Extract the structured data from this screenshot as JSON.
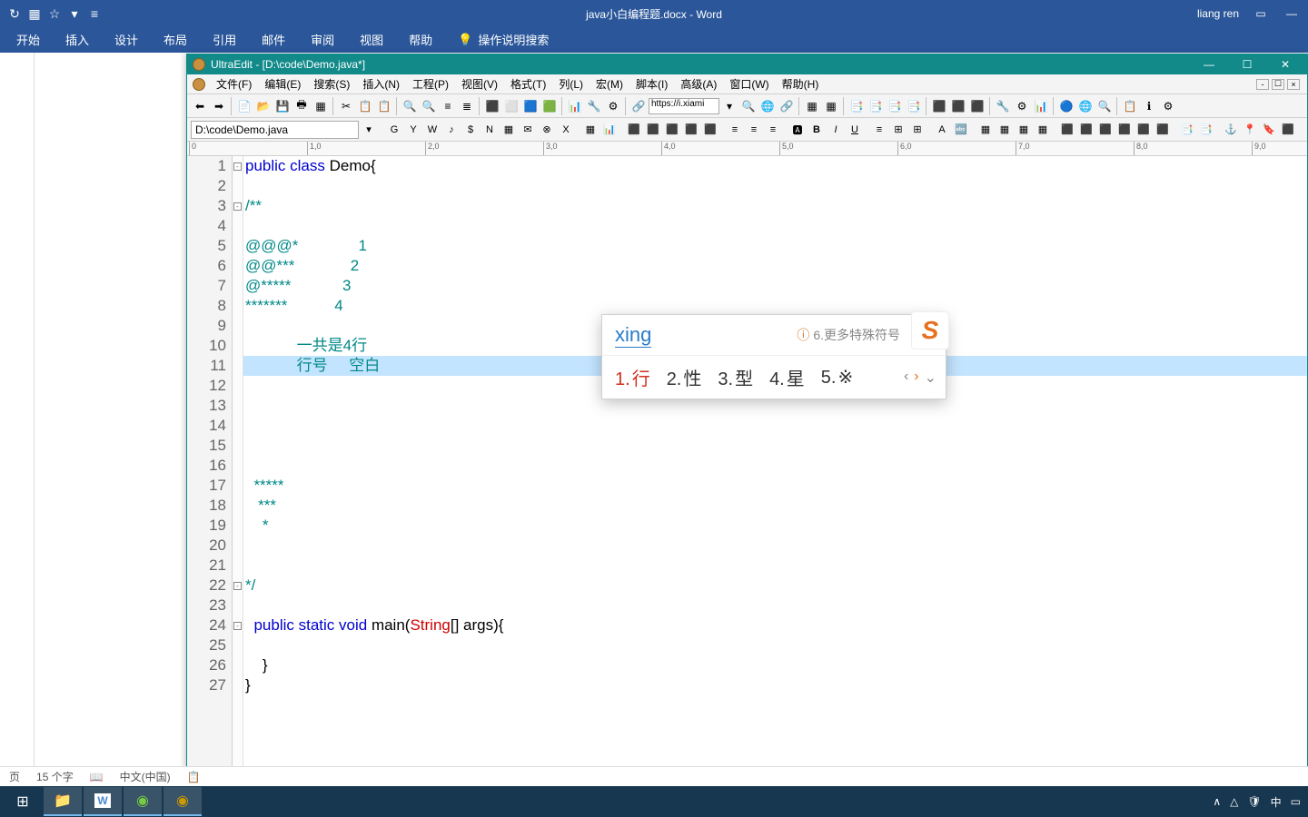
{
  "word": {
    "title": "java小白编程题.docx - Word",
    "user": "liang ren",
    "qat": [
      "↻",
      "▦",
      "☆",
      "▾",
      "≡"
    ],
    "tabs": [
      "开始",
      "插入",
      "设计",
      "布局",
      "引用",
      "邮件",
      "审阅",
      "视图",
      "帮助"
    ],
    "tellme": "操作说明搜索",
    "status": {
      "page": "页",
      "words": "15 个字",
      "lang": "中文(中国)"
    }
  },
  "ue": {
    "title": "UltraEdit - [D:\\code\\Demo.java*]",
    "menus": [
      "文件(F)",
      "编辑(E)",
      "搜索(S)",
      "插入(N)",
      "工程(P)",
      "视图(V)",
      "格式(T)",
      "列(L)",
      "宏(M)",
      "脚本(I)",
      "高级(A)",
      "窗口(W)",
      "帮助(H)"
    ],
    "url": "https://i.xiami",
    "file": "D:\\code\\Demo.java",
    "ruler_marks": [
      {
        "pos": 0,
        "label": "0"
      },
      {
        "pos": 130,
        "label": "1,0"
      },
      {
        "pos": 260,
        "label": "2,0"
      },
      {
        "pos": 390,
        "label": "3,0"
      },
      {
        "pos": 520,
        "label": "4,0"
      },
      {
        "pos": 650,
        "label": "5,0"
      },
      {
        "pos": 780,
        "label": "6,0"
      },
      {
        "pos": 910,
        "label": "7,0"
      },
      {
        "pos": 1040,
        "label": "8,0"
      },
      {
        "pos": 1170,
        "label": "9,0"
      }
    ],
    "lines": [
      {
        "n": 1,
        "fold": "-",
        "html": "<span class='kw'>public</span> <span class='kw'>class</span> Demo{"
      },
      {
        "n": 2,
        "fold": "",
        "html": ""
      },
      {
        "n": 3,
        "fold": "-",
        "html": "<span class='cm'>/**</span>"
      },
      {
        "n": 4,
        "fold": "",
        "html": ""
      },
      {
        "n": 5,
        "fold": "",
        "html": "<span class='cm'>@@@*              1</span>"
      },
      {
        "n": 6,
        "fold": "",
        "html": "<span class='cm'>@@***             2</span>"
      },
      {
        "n": 7,
        "fold": "",
        "html": "<span class='cm'>@*****            3</span>"
      },
      {
        "n": 8,
        "fold": "",
        "html": "<span class='cm'>*******           4</span>"
      },
      {
        "n": 9,
        "fold": "",
        "html": ""
      },
      {
        "n": 10,
        "fold": "",
        "html": "<span class='cm'>            一共是4行</span>"
      },
      {
        "n": 11,
        "fold": "",
        "html": "<span class='cm'>            行号     空白</span>",
        "hl": true
      },
      {
        "n": 12,
        "fold": "",
        "html": ""
      },
      {
        "n": 13,
        "fold": "",
        "html": ""
      },
      {
        "n": 14,
        "fold": "",
        "html": ""
      },
      {
        "n": 15,
        "fold": "",
        "html": ""
      },
      {
        "n": 16,
        "fold": "",
        "html": ""
      },
      {
        "n": 17,
        "fold": "",
        "html": "<span class='cm'>  *****</span>"
      },
      {
        "n": 18,
        "fold": "",
        "html": "<span class='cm'>   ***</span>"
      },
      {
        "n": 19,
        "fold": "",
        "html": "<span class='cm'>    *</span>"
      },
      {
        "n": 20,
        "fold": "",
        "html": ""
      },
      {
        "n": 21,
        "fold": "",
        "html": ""
      },
      {
        "n": 22,
        "fold": "-",
        "html": "<span class='cm'>*/</span>"
      },
      {
        "n": 23,
        "fold": "",
        "html": ""
      },
      {
        "n": 24,
        "fold": "-",
        "html": "  <span class='kw'>public</span> <span class='kw'>static</span> <span class='kw'>void</span> main(<span class='cls'>String</span>[] args){"
      },
      {
        "n": 25,
        "fold": "",
        "html": ""
      },
      {
        "n": 26,
        "fold": "",
        "html": "    }"
      },
      {
        "n": 27,
        "fold": "",
        "html": "}"
      }
    ]
  },
  "ime": {
    "pinyin": "xing",
    "hint": "6.更多特殊符号",
    "logo": "S",
    "candidates": [
      {
        "n": "1.",
        "w": "行",
        "sel": true
      },
      {
        "n": "2.",
        "w": "性"
      },
      {
        "n": "3.",
        "w": "型"
      },
      {
        "n": "4.",
        "w": "星"
      },
      {
        "n": "5.",
        "w": "※"
      }
    ]
  },
  "taskbar": {
    "tray": [
      "∧",
      "△",
      "🛡",
      "中",
      "▭"
    ]
  }
}
